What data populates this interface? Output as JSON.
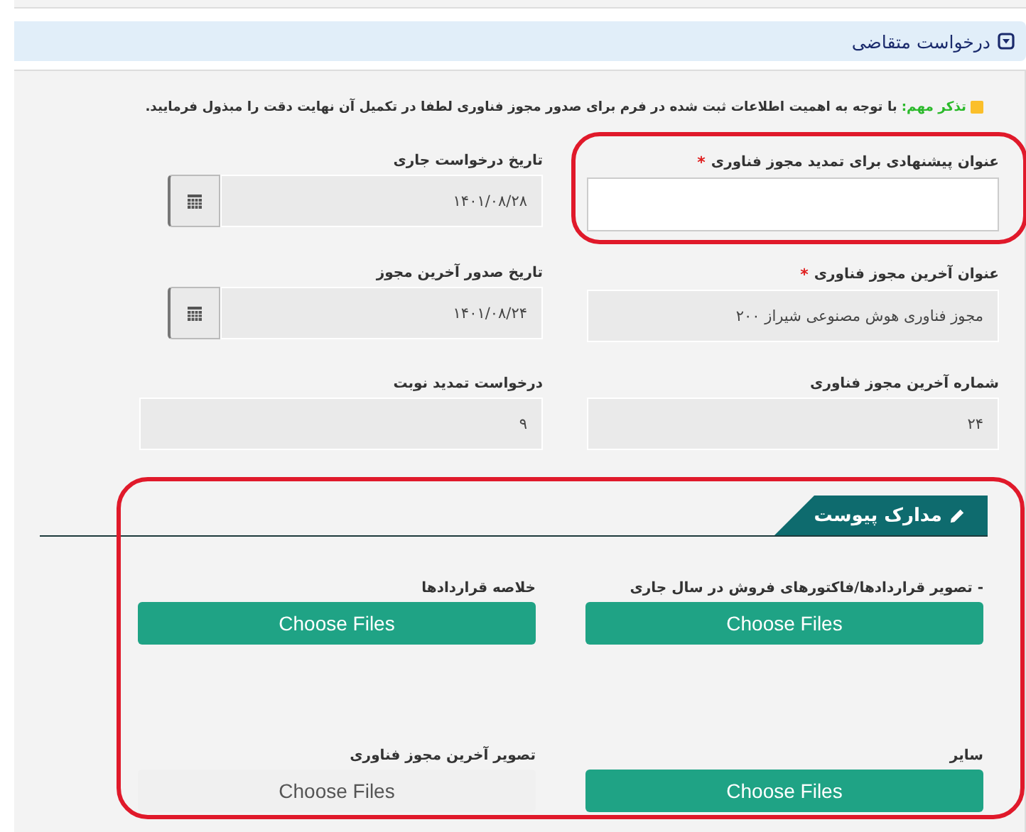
{
  "header": {
    "title": "درخواست متقاضی",
    "expanded": true
  },
  "notice": {
    "label": "تذکر مهم:",
    "text": "با توجه به اهمیت اطلاعات ثبت شده در فرم برای صدور مجوز فناوری لطفا در تکمیل آن نهایت دقت را مبذول فرمایید."
  },
  "fields": [
    {
      "kind": "text",
      "label": "عنوان پیشنهادی برای تمدید مجوز فناوری",
      "required_mark": "*",
      "editable": true,
      "highlighted": true
    },
    {
      "kind": "date",
      "label": "تاریخ درخواست جاری",
      "editable": false,
      "highlighted": false,
      "value": "۱۴۰۱/۰۸/۲۸"
    },
    {
      "kind": "text",
      "label": "عنوان آخرین مجوز فناوری",
      "required_mark": "*",
      "editable": false,
      "highlighted": false,
      "value": "مجوز فناوری هوش مصنوعی شیراز ۲۰۰"
    },
    {
      "kind": "date",
      "label": "تاریخ صدور آخرین مجوز",
      "editable": false,
      "highlighted": false,
      "value": "۱۴۰۱/۰۸/۲۴"
    },
    {
      "kind": "text",
      "label": "شماره آخرین مجوز فناوری",
      "editable": false,
      "highlighted": false,
      "value": "۲۴"
    },
    {
      "kind": "text",
      "label": "درخواست تمدید نوبت",
      "editable": false,
      "highlighted": false,
      "value": "۹"
    }
  ],
  "attachments": {
    "title": "مدارک پیوست",
    "highlighted": true,
    "items": [
      {
        "label": "- تصویر قراردادها/فاکتورهای فروش در سال جاری",
        "button": "Choose Files",
        "disabled": false
      },
      {
        "label": "خلاصه قراردادها",
        "button": "Choose Files",
        "disabled": false
      },
      {
        "label": "سایر",
        "button": "Choose Files",
        "disabled": false
      },
      {
        "label": "تصویر آخرین مجوز فناوری",
        "button": "Choose Files",
        "disabled": true
      }
    ]
  }
}
